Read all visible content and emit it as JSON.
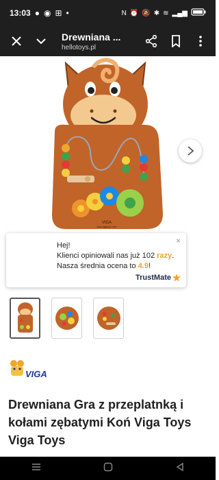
{
  "status_bar": {
    "time": "13:03"
  },
  "app_bar": {
    "title": "Drewniana ...",
    "url": "hellotoys.pl"
  },
  "popup": {
    "line1": "Hej!",
    "line2a": "Klienci opiniowali nas już 102 ",
    "line2b": "razy",
    "line2c": ".",
    "line3a": "Nasza średnia ocena to ",
    "line3b": "4.9",
    "line3c": "!",
    "close": "×",
    "brand": "TrustMate"
  },
  "product": {
    "title": "Drewniana Gra z przeplatnką i kołami zębatymi Koń Viga Toys Viga Toys",
    "board_brand": "VIGA",
    "board_url": "www.vigatoys.com",
    "logo_text": "VIGA"
  },
  "colors": {
    "accent": "#f0a12d",
    "wood": "#c0642a",
    "dark": "#1f1f1f"
  }
}
